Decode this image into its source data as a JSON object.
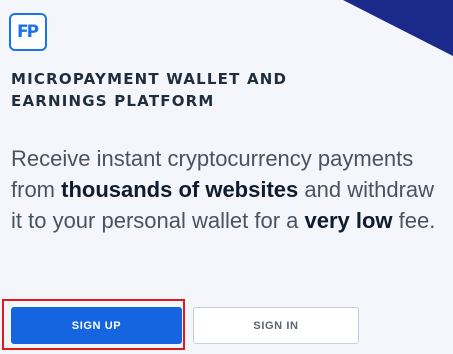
{
  "brand": {
    "logo_text": "FP",
    "logo_color": "#1a73e8",
    "corner_color": "#1b2a8a"
  },
  "hero": {
    "tagline_line1": "MICROPAYMENT WALLET AND",
    "tagline_line2": "EARNINGS PLATFORM",
    "description": {
      "part1": "Receive instant cryptocurrency payments from ",
      "bold1": "thousands of websites",
      "part2": " and withdraw it to your personal wallet for a ",
      "bold2": "very low",
      "part3": " fee."
    }
  },
  "actions": {
    "signup_label": "SIGN UP",
    "signin_label": "SIGN IN",
    "primary_color": "#1565e0",
    "highlight_color": "#e01b1b"
  }
}
